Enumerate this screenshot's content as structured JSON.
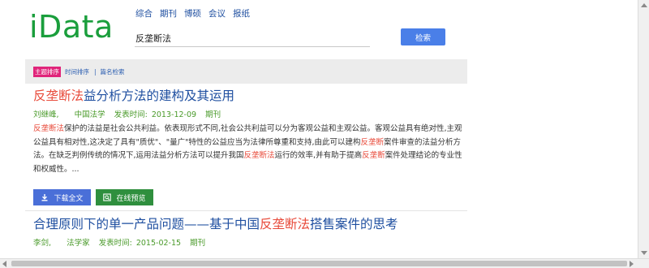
{
  "brand": {
    "logo": "iData"
  },
  "nav": [
    "综合",
    "期刊",
    "博硕",
    "会议",
    "报纸"
  ],
  "search": {
    "value": "反垄断法",
    "button": "检索"
  },
  "sort": {
    "active": "主题排序",
    "time": "时间排序",
    "sep": "|",
    "title": "篇名检索"
  },
  "results": [
    {
      "title_hl": "反垄断法",
      "title_rest": "益分析方法的建构及其运用",
      "author": "刘继峰,",
      "journal": "中国法学",
      "date_label": "发表时间:",
      "date": "2013-12-09",
      "type": "期刊",
      "snippet": [
        {
          "t": "反垄断法",
          "hl": true
        },
        {
          "t": "保护的法益是社会公共利益。依表现形式不同,社会公共利益可以分为客观公益和主观公益。客观公益具有绝对性,主观公益具有相对性,这决定了具有\"质优\"、\"量广\"特性的公益应当为法律所尊重和支持,由此可以建构",
          "hl": false
        },
        {
          "t": "反垄断",
          "hl": true
        },
        {
          "t": "案件审查的法益分析方法。在缺乏判例传统的情况下,运用法益分析方法可以提升我国",
          "hl": false
        },
        {
          "t": "反垄断法",
          "hl": true
        },
        {
          "t": "运行的效率,并有助于提高",
          "hl": false
        },
        {
          "t": "反垄断",
          "hl": true
        },
        {
          "t": "案件处理结论的专业性和权威性。...",
          "hl": false
        }
      ]
    },
    {
      "title_pre": "合理原则下的单一产品问题——基于中国",
      "title_hl": "反垄断法",
      "title_rest": "搭售案件的思考",
      "author": "李剑,",
      "journal": "法学家",
      "date_label": "发表时间:",
      "date": "2015-02-15",
      "type": "期刊"
    }
  ],
  "actions": {
    "download": "下载全文",
    "preview": "在线预览"
  },
  "colors": {
    "logo": "#1a9e3c",
    "link": "#1f4fa0",
    "highlight": "#e84a3a",
    "meta": "#4a9a2a",
    "active_sort": "#e0247a",
    "download_bg": "#4a6fd8",
    "preview_bg": "#2f8f3e",
    "search_btn": "#4a7fe8"
  },
  "icons": {
    "download": "download-icon",
    "preview": "preview-icon"
  }
}
